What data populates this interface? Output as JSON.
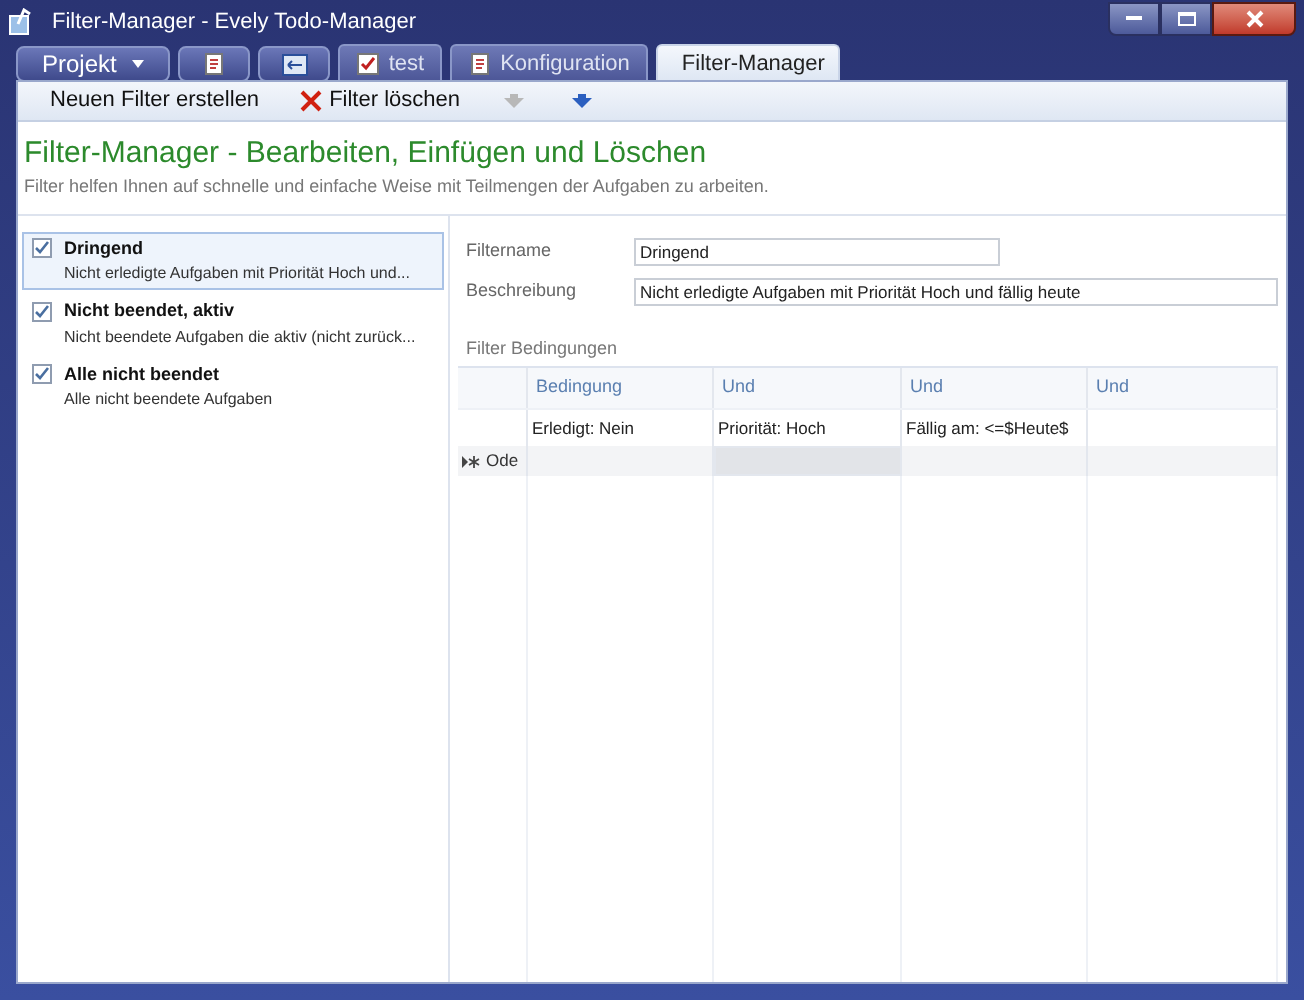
{
  "window": {
    "title": "Filter-Manager - Evely Todo-Manager"
  },
  "tabs": [
    {
      "kind": "menu",
      "label": "Projekt",
      "selected": false
    },
    {
      "kind": "iconbutton",
      "selected": false
    },
    {
      "kind": "iconbutton",
      "selected": false
    },
    {
      "kind": "doc",
      "label": "test",
      "selected": false
    },
    {
      "kind": "doc",
      "label": "Konfiguration",
      "selected": false
    },
    {
      "kind": "doc",
      "label": "Filter-Manager",
      "selected": true
    }
  ],
  "toolbar": [
    {
      "kind": "text",
      "label": "Neuen Filter erstellen",
      "disabled": false
    },
    {
      "kind": "delete",
      "label": "Filter löschen",
      "disabled": false
    },
    {
      "kind": "arrow",
      "disabled": true
    },
    {
      "kind": "arrow",
      "disabled": false
    }
  ],
  "header": {
    "title": "Filter-Manager - Bearbeiten, Einfügen und Löschen",
    "subtitle": "Filter helfen Ihnen auf schnelle und einfache Weise mit Teilmengen der Aufgaben zu arbeiten."
  },
  "filters": [
    {
      "name": "Dringend",
      "description": "Nicht erledigte Aufgaben mit Priorität Hoch und...",
      "checked": true,
      "selected": true
    },
    {
      "name": "Nicht beendet, aktiv",
      "description": "Nicht beendete Aufgaben die aktiv (nicht zurück...",
      "checked": true,
      "selected": false
    },
    {
      "name": "Alle nicht beendet",
      "description": "Alle nicht beendete Aufgaben",
      "checked": true,
      "selected": false
    }
  ],
  "form": {
    "fields": [
      {
        "label": "Filtername",
        "value": "Dringend",
        "kind": "short"
      },
      {
        "label": "Beschreibung",
        "value": "Nicht erledigte Aufgaben mit Priorität Hoch und fällig heute",
        "kind": "long"
      }
    ],
    "section": "Filter Bedingungen",
    "grid": {
      "columns": [
        "Bedingung",
        "Und",
        "Und",
        "Und"
      ],
      "rows": [
        {
          "kind": "data",
          "header": "",
          "cells": [
            "Erledigt: Nein",
            "Priorität: Hoch",
            "Fällig am: <=$Heute$",
            ""
          ]
        },
        {
          "kind": "new",
          "header": "Ode",
          "cells": [
            "",
            "",
            "",
            ""
          ]
        }
      ]
    }
  }
}
